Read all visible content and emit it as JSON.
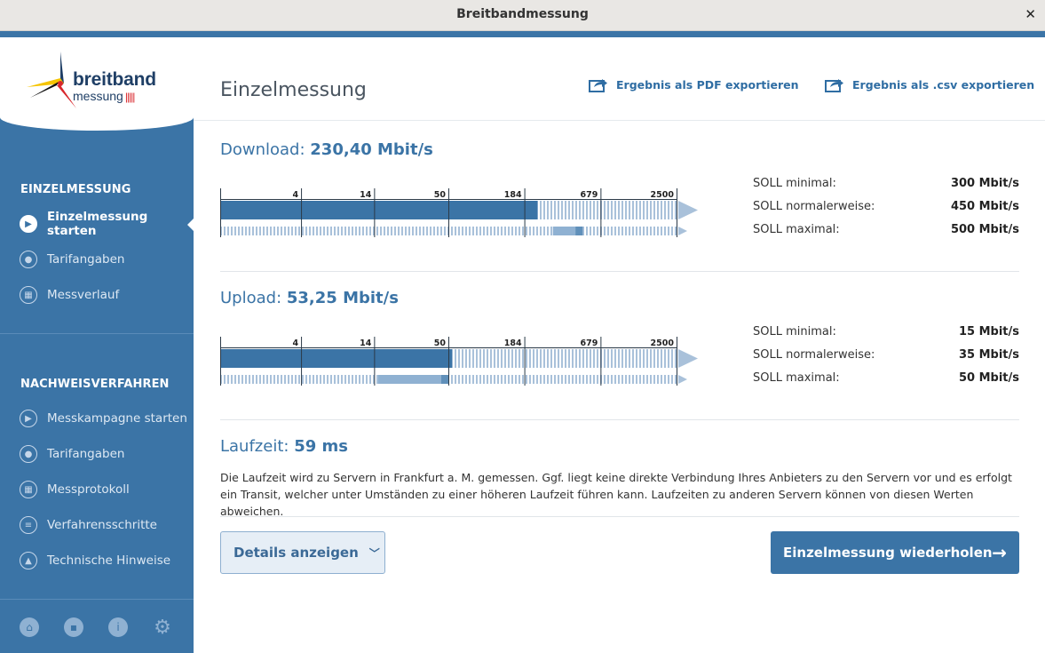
{
  "window": {
    "title": "Breitbandmessung",
    "close_glyph": "✕"
  },
  "logo": {
    "word1": "breitband",
    "word2": "messung",
    "bars_glyph": "|||||"
  },
  "sidebar": {
    "section1": "EINZELMESSUNG",
    "items1": [
      {
        "label": "Einzelmessung starten",
        "icon": "play-icon"
      },
      {
        "label": "Tarifangaben",
        "icon": "user-card-icon"
      },
      {
        "label": "Messverlauf",
        "icon": "calendar-icon"
      }
    ],
    "section2": "NACHWEISVERFAHREN",
    "items2": [
      {
        "label": "Messkampagne starten",
        "icon": "play-icon"
      },
      {
        "label": "Tarifangaben",
        "icon": "user-card-icon"
      },
      {
        "label": "Messprotokoll",
        "icon": "calendar-icon"
      },
      {
        "label": "Verfahrensschritte",
        "icon": "list-icon"
      },
      {
        "label": "Technische Hinweise",
        "icon": "warning-icon"
      }
    ],
    "bottom_icons": [
      "home-icon",
      "chat-icon",
      "info-icon",
      "gear-icon"
    ]
  },
  "main": {
    "title": "Einzelmessung",
    "export_pdf": "Ergebnis als PDF exportieren",
    "export_csv": "Ergebnis als .csv exportieren",
    "download": {
      "label": "Download:",
      "value": "230,40 Mbit/s",
      "soll": [
        {
          "label": "SOLL minimal:",
          "value": "300 Mbit/s"
        },
        {
          "label": "SOLL normalerweise:",
          "value": "450 Mbit/s"
        },
        {
          "label": "SOLL maximal:",
          "value": "500 Mbit/s"
        }
      ]
    },
    "upload": {
      "label": "Upload:",
      "value": "53,25 Mbit/s",
      "soll": [
        {
          "label": "SOLL minimal:",
          "value": "15 Mbit/s"
        },
        {
          "label": "SOLL normalerweise:",
          "value": "35 Mbit/s"
        },
        {
          "label": "SOLL maximal:",
          "value": "50 Mbit/s"
        }
      ]
    },
    "latency": {
      "label": "Laufzeit:",
      "value": "59 ms",
      "text": "Die Laufzeit wird zu Servern in Frankfurt a. M. gemessen. Ggf. liegt keine direkte Verbindung Ihres Anbieters zu den Servern vor und es erfolgt ein Transit, welcher unter Umständen zu einer höheren Laufzeit führen kann. Laufzeiten zu anderen Servern können von diesen Werten abweichen."
    },
    "btn_details": "Details anzeigen",
    "btn_repeat": "Einzelmessung wiederholen"
  },
  "gauge": {
    "ticks": [
      "4",
      "14",
      "50",
      "184",
      "679",
      "2500"
    ],
    "download_fill": 230.4,
    "download_soll_range": [
      300,
      500
    ],
    "upload_fill": 53.25,
    "upload_soll_range": [
      15,
      50
    ],
    "colors": {
      "fill": "#3b74a6",
      "stripe": "#a9c1da",
      "range": "#8fb1d2",
      "arrow": "#a9c1da"
    }
  },
  "colors": {
    "accent": "#3b74a6",
    "text_blue": "#2f6da3"
  }
}
